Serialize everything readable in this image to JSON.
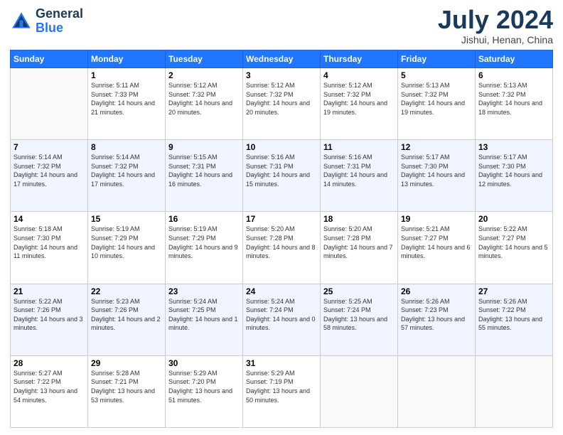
{
  "logo": {
    "line1": "General",
    "line2": "Blue"
  },
  "title": "July 2024",
  "location": "Jishui, Henan, China",
  "weekdays": [
    "Sunday",
    "Monday",
    "Tuesday",
    "Wednesday",
    "Thursday",
    "Friday",
    "Saturday"
  ],
  "weeks": [
    [
      {
        "day": "",
        "sunrise": "",
        "sunset": "",
        "daylight": ""
      },
      {
        "day": "1",
        "sunrise": "Sunrise: 5:11 AM",
        "sunset": "Sunset: 7:33 PM",
        "daylight": "Daylight: 14 hours and 21 minutes."
      },
      {
        "day": "2",
        "sunrise": "Sunrise: 5:12 AM",
        "sunset": "Sunset: 7:32 PM",
        "daylight": "Daylight: 14 hours and 20 minutes."
      },
      {
        "day": "3",
        "sunrise": "Sunrise: 5:12 AM",
        "sunset": "Sunset: 7:32 PM",
        "daylight": "Daylight: 14 hours and 20 minutes."
      },
      {
        "day": "4",
        "sunrise": "Sunrise: 5:12 AM",
        "sunset": "Sunset: 7:32 PM",
        "daylight": "Daylight: 14 hours and 19 minutes."
      },
      {
        "day": "5",
        "sunrise": "Sunrise: 5:13 AM",
        "sunset": "Sunset: 7:32 PM",
        "daylight": "Daylight: 14 hours and 19 minutes."
      },
      {
        "day": "6",
        "sunrise": "Sunrise: 5:13 AM",
        "sunset": "Sunset: 7:32 PM",
        "daylight": "Daylight: 14 hours and 18 minutes."
      }
    ],
    [
      {
        "day": "7",
        "sunrise": "Sunrise: 5:14 AM",
        "sunset": "Sunset: 7:32 PM",
        "daylight": "Daylight: 14 hours and 17 minutes."
      },
      {
        "day": "8",
        "sunrise": "Sunrise: 5:14 AM",
        "sunset": "Sunset: 7:32 PM",
        "daylight": "Daylight: 14 hours and 17 minutes."
      },
      {
        "day": "9",
        "sunrise": "Sunrise: 5:15 AM",
        "sunset": "Sunset: 7:31 PM",
        "daylight": "Daylight: 14 hours and 16 minutes."
      },
      {
        "day": "10",
        "sunrise": "Sunrise: 5:16 AM",
        "sunset": "Sunset: 7:31 PM",
        "daylight": "Daylight: 14 hours and 15 minutes."
      },
      {
        "day": "11",
        "sunrise": "Sunrise: 5:16 AM",
        "sunset": "Sunset: 7:31 PM",
        "daylight": "Daylight: 14 hours and 14 minutes."
      },
      {
        "day": "12",
        "sunrise": "Sunrise: 5:17 AM",
        "sunset": "Sunset: 7:30 PM",
        "daylight": "Daylight: 14 hours and 13 minutes."
      },
      {
        "day": "13",
        "sunrise": "Sunrise: 5:17 AM",
        "sunset": "Sunset: 7:30 PM",
        "daylight": "Daylight: 14 hours and 12 minutes."
      }
    ],
    [
      {
        "day": "14",
        "sunrise": "Sunrise: 5:18 AM",
        "sunset": "Sunset: 7:30 PM",
        "daylight": "Daylight: 14 hours and 11 minutes."
      },
      {
        "day": "15",
        "sunrise": "Sunrise: 5:19 AM",
        "sunset": "Sunset: 7:29 PM",
        "daylight": "Daylight: 14 hours and 10 minutes."
      },
      {
        "day": "16",
        "sunrise": "Sunrise: 5:19 AM",
        "sunset": "Sunset: 7:29 PM",
        "daylight": "Daylight: 14 hours and 9 minutes."
      },
      {
        "day": "17",
        "sunrise": "Sunrise: 5:20 AM",
        "sunset": "Sunset: 7:28 PM",
        "daylight": "Daylight: 14 hours and 8 minutes."
      },
      {
        "day": "18",
        "sunrise": "Sunrise: 5:20 AM",
        "sunset": "Sunset: 7:28 PM",
        "daylight": "Daylight: 14 hours and 7 minutes."
      },
      {
        "day": "19",
        "sunrise": "Sunrise: 5:21 AM",
        "sunset": "Sunset: 7:27 PM",
        "daylight": "Daylight: 14 hours and 6 minutes."
      },
      {
        "day": "20",
        "sunrise": "Sunrise: 5:22 AM",
        "sunset": "Sunset: 7:27 PM",
        "daylight": "Daylight: 14 hours and 5 minutes."
      }
    ],
    [
      {
        "day": "21",
        "sunrise": "Sunrise: 5:22 AM",
        "sunset": "Sunset: 7:26 PM",
        "daylight": "Daylight: 14 hours and 3 minutes."
      },
      {
        "day": "22",
        "sunrise": "Sunrise: 5:23 AM",
        "sunset": "Sunset: 7:26 PM",
        "daylight": "Daylight: 14 hours and 2 minutes."
      },
      {
        "day": "23",
        "sunrise": "Sunrise: 5:24 AM",
        "sunset": "Sunset: 7:25 PM",
        "daylight": "Daylight: 14 hours and 1 minute."
      },
      {
        "day": "24",
        "sunrise": "Sunrise: 5:24 AM",
        "sunset": "Sunset: 7:24 PM",
        "daylight": "Daylight: 14 hours and 0 minutes."
      },
      {
        "day": "25",
        "sunrise": "Sunrise: 5:25 AM",
        "sunset": "Sunset: 7:24 PM",
        "daylight": "Daylight: 13 hours and 58 minutes."
      },
      {
        "day": "26",
        "sunrise": "Sunrise: 5:26 AM",
        "sunset": "Sunset: 7:23 PM",
        "daylight": "Daylight: 13 hours and 57 minutes."
      },
      {
        "day": "27",
        "sunrise": "Sunrise: 5:26 AM",
        "sunset": "Sunset: 7:22 PM",
        "daylight": "Daylight: 13 hours and 55 minutes."
      }
    ],
    [
      {
        "day": "28",
        "sunrise": "Sunrise: 5:27 AM",
        "sunset": "Sunset: 7:22 PM",
        "daylight": "Daylight: 13 hours and 54 minutes."
      },
      {
        "day": "29",
        "sunrise": "Sunrise: 5:28 AM",
        "sunset": "Sunset: 7:21 PM",
        "daylight": "Daylight: 13 hours and 53 minutes."
      },
      {
        "day": "30",
        "sunrise": "Sunrise: 5:29 AM",
        "sunset": "Sunset: 7:20 PM",
        "daylight": "Daylight: 13 hours and 51 minutes."
      },
      {
        "day": "31",
        "sunrise": "Sunrise: 5:29 AM",
        "sunset": "Sunset: 7:19 PM",
        "daylight": "Daylight: 13 hours and 50 minutes."
      },
      {
        "day": "",
        "sunrise": "",
        "sunset": "",
        "daylight": ""
      },
      {
        "day": "",
        "sunrise": "",
        "sunset": "",
        "daylight": ""
      },
      {
        "day": "",
        "sunrise": "",
        "sunset": "",
        "daylight": ""
      }
    ]
  ]
}
